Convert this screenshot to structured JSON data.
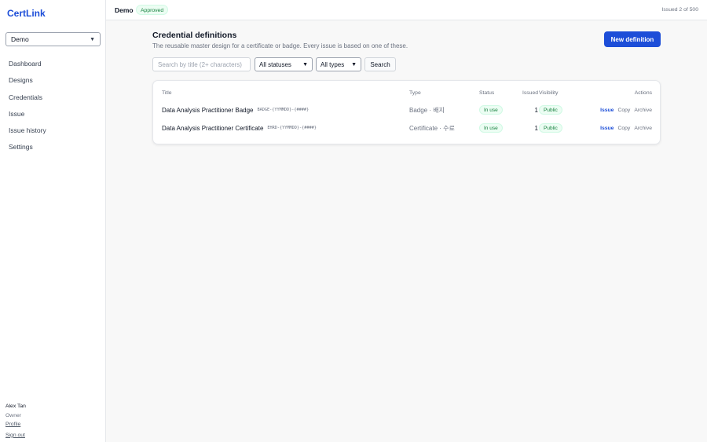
{
  "sidebar": {
    "brand": "CertLink",
    "org_select": {
      "selected": "Demo"
    },
    "items": [
      {
        "label": "Dashboard"
      },
      {
        "label": "Designs"
      },
      {
        "label": "Credentials"
      },
      {
        "label": "Issue"
      },
      {
        "label": "Issue history"
      },
      {
        "label": "Settings"
      }
    ],
    "user": {
      "name": "Alex Tan",
      "role": "Owner",
      "profile_label": "Profile",
      "signout_label": "Sign out"
    }
  },
  "topbar": {
    "org_name": "Demo",
    "status_badge": "Approved",
    "quota": "Issued 2 of 500"
  },
  "main": {
    "title": "Credential definitions",
    "subtitle": "The reusable master design for a certificate or badge. Every issue is based on one of these.",
    "new_button": "New definition",
    "filters": {
      "search_placeholder": "Search by title (2+ characters)",
      "status_selected": "All statuses",
      "type_selected": "All types",
      "search_button": "Search"
    },
    "table": {
      "headers": {
        "title": "Title",
        "type": "Type",
        "status": "Status",
        "issued": "Issued",
        "visibility": "Visibility",
        "actions": "Actions"
      },
      "rows": [
        {
          "title": "Data Analysis Practitioner Badge",
          "code": "BADGE-{YYMMDD}-{####}",
          "type": "Badge · 배지",
          "status": "In use",
          "issued": "1",
          "visibility": "Public",
          "actions": {
            "issue": "Issue",
            "copy": "Copy",
            "archive": "Archive"
          }
        },
        {
          "title": "Data Analysis Practitioner Certificate",
          "code": "EHRD-{YYMMDD}-{####}",
          "type": "Certificate · 수료",
          "status": "In use",
          "issued": "1",
          "visibility": "Public",
          "actions": {
            "issue": "Issue",
            "copy": "Copy",
            "archive": "Archive"
          }
        }
      ]
    }
  },
  "colors": {
    "accent": "#1d4ed8",
    "success_text": "#15803d",
    "success_bg": "#ecfdf3"
  }
}
